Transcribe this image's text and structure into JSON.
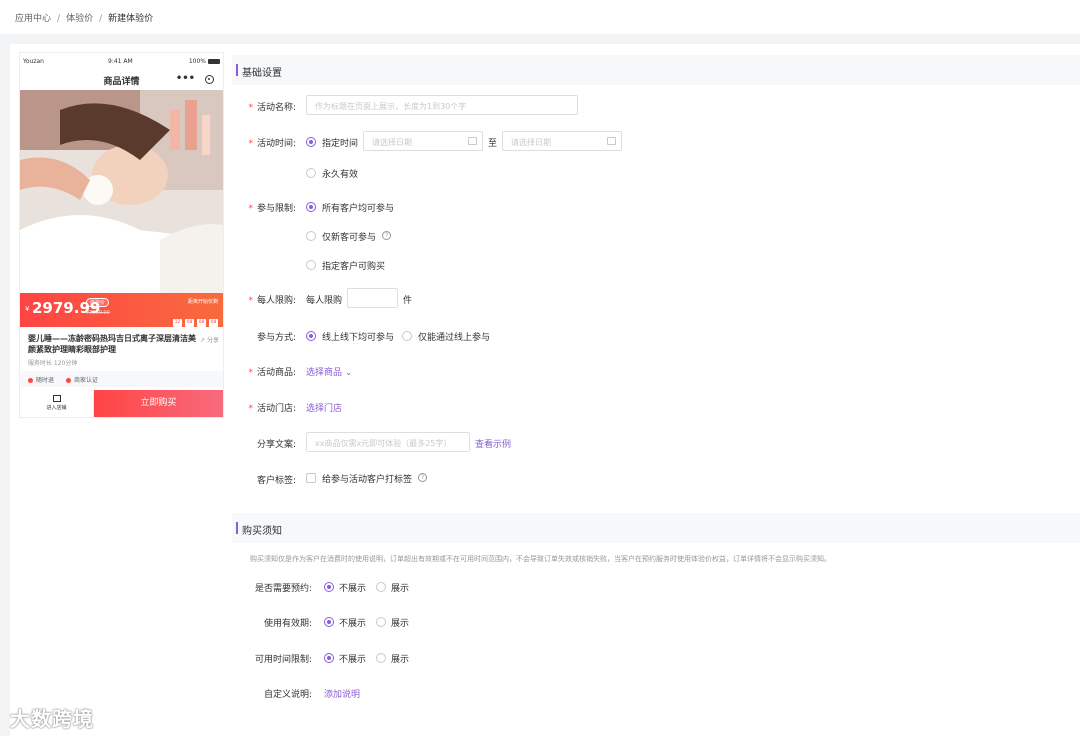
{
  "breadcrumb": {
    "items": [
      "应用中心",
      "体验价",
      "新建体验价"
    ]
  },
  "phone": {
    "status": {
      "carrier": "Youzan",
      "time": "9:41 AM",
      "battery": "100%"
    },
    "nav_title": "商品详情",
    "price_symbol": "¥",
    "price": "2979.99",
    "price_tag": "体验价",
    "original_price": "¥3000.00",
    "countdown_label": "距离开始仅剩",
    "countdown": [
      "12",
      "08",
      "08",
      "08"
    ],
    "product_title": "婴儿睡——冻龄密码热玛吉日式离子深层清洁美颜紧致护理睛彩眼部护理",
    "share_label": "分享",
    "duration": "服务时长 120分钟",
    "tags": [
      "随时退",
      "商家认证"
    ],
    "shop_label": "进入店铺",
    "buy_label": "立即购买"
  },
  "basic": {
    "section_title": "基础设置",
    "name_label": "活动名称:",
    "name_placeholder": "作为标题在页面上展示，长度为1到30个字",
    "time_label": "活动时间:",
    "time_opt1": "指定时间",
    "date_placeholder": "请选择日期",
    "to_label": "至",
    "time_opt2": "永久有效",
    "limit_label": "参与限制:",
    "limit_opt1": "所有客户均可参与",
    "limit_opt2": "仅新客可参与",
    "limit_opt3": "指定客户可购买",
    "per_label": "每人限购:",
    "per_prefix": "每人限购",
    "per_suffix": "件",
    "mode_label": "参与方式:",
    "mode_opt1": "线上线下均可参与",
    "mode_opt2": "仅能通过线上参与",
    "goods_label": "活动商品:",
    "goods_link": "选择商品",
    "store_label": "活动门店:",
    "store_link": "选择门店",
    "share_label": "分享文案:",
    "share_placeholder": "xx商品仅需x元即可体验（最多25字）",
    "share_example": "查看示例",
    "tag_label": "客户标签:",
    "tag_opt": "给参与活动客户打标签"
  },
  "notice": {
    "section_title": "购买须知",
    "description": "购买须知仅是作为客户在消费时的使用说明，订单超出有效期或不在可用时间范围内，不会导致订单失效或核销失败，当客户在预约服务时使用体验价权益，订单详情将不会显示购买须知。",
    "rows": [
      {
        "label": "是否需要预约:",
        "opt1": "不展示",
        "opt2": "展示"
      },
      {
        "label": "使用有效期:",
        "opt1": "不展示",
        "opt2": "展示"
      },
      {
        "label": "可用时间限制:",
        "opt1": "不展示",
        "opt2": "展示"
      }
    ],
    "custom_label": "自定义说明:",
    "custom_link": "添加说明"
  },
  "watermark": "大数跨境",
  "colors": {
    "accent": "#8a5cd6",
    "required": "#ff4444",
    "buy": "#ff4444"
  }
}
